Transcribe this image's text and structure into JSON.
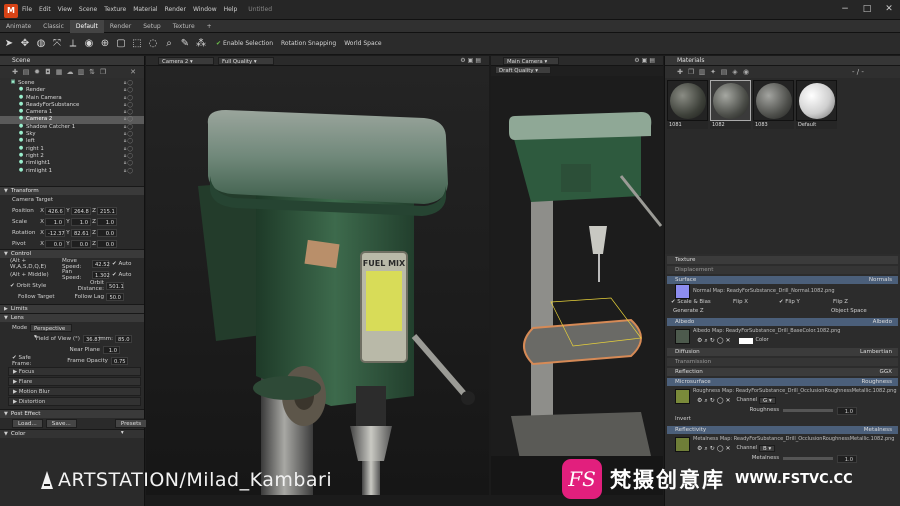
{
  "app": {
    "title": "Untitled",
    "menu": [
      "File",
      "Edit",
      "View",
      "Scene",
      "Texture",
      "Material",
      "Render",
      "Window",
      "Help"
    ],
    "workspace_tabs": [
      "Animate",
      "Classic",
      "Default",
      "Render",
      "Setup",
      "Texture",
      "+"
    ],
    "active_tab": "Default"
  },
  "toolbar": {
    "enable_selection": "Enable Selection",
    "rotation_snapping": "Rotation Snapping",
    "world_space": "World Space"
  },
  "scene": {
    "panel_title": "Scene",
    "tree": [
      {
        "label": "Scene",
        "indent": 0
      },
      {
        "label": "Render",
        "indent": 1
      },
      {
        "label": "Main Camera",
        "indent": 1
      },
      {
        "label": "ReadyForSubstance",
        "indent": 1
      },
      {
        "label": "Camera 1",
        "indent": 1
      },
      {
        "label": "Camera 2",
        "indent": 1,
        "selected": true
      },
      {
        "label": "Shadow Catcher 1",
        "indent": 1
      },
      {
        "label": "Sky",
        "indent": 1
      },
      {
        "label": "left",
        "indent": 1
      },
      {
        "label": "right 1",
        "indent": 1
      },
      {
        "label": "right 2",
        "indent": 1
      },
      {
        "label": "rimlight1",
        "indent": 1
      },
      {
        "label": "rimlight 1",
        "indent": 1
      }
    ]
  },
  "transform": {
    "section": "Transform",
    "target": "Camera Target",
    "position": {
      "label": "Position",
      "x": "426.6",
      "y": "264.8",
      "z": "215.1"
    },
    "scale": {
      "label": "Scale",
      "x": "1.0",
      "y": "1.0",
      "z": "1.0"
    },
    "rotation": {
      "label": "Rotation",
      "x": "-12.37",
      "y": "82.61",
      "z": "0.0"
    },
    "pivot": {
      "label": "Pivot",
      "x": "0.0",
      "y": "0.0",
      "z": "0.0"
    }
  },
  "control": {
    "section": "Control",
    "move_key": "(Alt + W,A,S,D,Q,E)",
    "move_speed_label": "Move Speed:",
    "move_speed": "42.52",
    "auto": "Auto",
    "pan_key": "(Alt + Middle)",
    "pan_speed_label": "Pan Speed:",
    "pan_speed": "1.302",
    "orbit_style": "Orbit Style",
    "orbit_distance_label": "Orbit Distance:",
    "orbit_distance": "501.1",
    "follow_target": "Follow Target",
    "follow_lag_label": "Follow Lag",
    "follow_lag": "50.0"
  },
  "limits": {
    "section": "Limits"
  },
  "lens": {
    "section": "Lens",
    "mode_label": "Mode",
    "mode": "Perspective",
    "fov_label": "Field of View (°)",
    "fov": "36.87",
    "mm_label": "mm:",
    "mm": "85.0",
    "near_plane_label": "Near Plane",
    "near_plane": "1.0",
    "safe_frame": "Safe Frame:",
    "frame_opacity_label": "Frame Opacity",
    "frame_opacity": "0.75",
    "subsections": [
      "Focus",
      "Flare",
      "Motion Blur",
      "Distortion"
    ]
  },
  "post_effect": {
    "section": "Post Effect",
    "load": "Load...",
    "save": "Save...",
    "presets": "Presets",
    "color": "Color"
  },
  "viewport_left": {
    "camera": "Camera 2",
    "quality": "Full Quality"
  },
  "viewport_right": {
    "camera": "Main Camera",
    "quality": "Draft Quality"
  },
  "materials": {
    "panel_title": "Materials",
    "search": "- / -",
    "items": [
      {
        "name": "1081",
        "color": "#5b5d55"
      },
      {
        "name": "1082",
        "color": "#6a6c66"
      },
      {
        "name": "1083",
        "color": "#6e6f6b"
      },
      {
        "name": "Default",
        "color": "#d8d8d8"
      }
    ],
    "sections": {
      "texture": "Texture",
      "displacement": "Displacement",
      "surface": "Surface",
      "surface_mode": "Normals",
      "normal_map_label": "Normal Map:",
      "normal_map": "ReadyForSubstance_Drill_Normal.1082.png",
      "scale_bias": "Scale & Bias",
      "flip_x": "Flip X",
      "flip_y": "Flip Y",
      "flip_z": "Flip Z",
      "generate_z": "Generate Z",
      "object_space": "Object Space",
      "albedo": "Albedo",
      "albedo_mode": "Albedo",
      "albedo_map_label": "Albedo Map:",
      "albedo_map": "ReadyForSubstance_Drill_BaseColor.1082.png",
      "color": "Color",
      "diffusion": "Diffusion",
      "diffusion_mode": "Lambertian",
      "transmission": "Transmission",
      "reflection": "Reflection",
      "reflection_mode": "GGX",
      "microsurface": "Microsurface",
      "microsurface_mode": "Roughness",
      "roughness_map_label": "Roughness Map:",
      "roughness_map": "ReadyForSubstance_Drill_OcclusionRoughnessMetallic.1082.png",
      "channel_label": "Channel",
      "channel_g": "G",
      "roughness_label": "Roughness",
      "roughness": "1.0",
      "invert": "Invert",
      "reflectivity": "Reflectivity",
      "reflectivity_mode": "Metalness",
      "metalness_map_label": "Metalness Map:",
      "metalness_map": "ReadyForSubstance_Drill_OcclusionRoughnessMetallic.1082.png",
      "channel_b": "B",
      "metalness_label": "Metalness",
      "metalness": "1.0"
    }
  },
  "watermark": {
    "artstation": "ARTSTATION/Milad_Kambari",
    "fs_badge": "FS",
    "fs_cn": "梵摄创意库",
    "fs_url": "WWW.FSTVC.CC"
  },
  "colors": {
    "accent_blue": "#4b5f7a",
    "green_check": "#6cc24a",
    "drill_green": "#2f5a3f",
    "fs_pink": "#e21f7d"
  }
}
